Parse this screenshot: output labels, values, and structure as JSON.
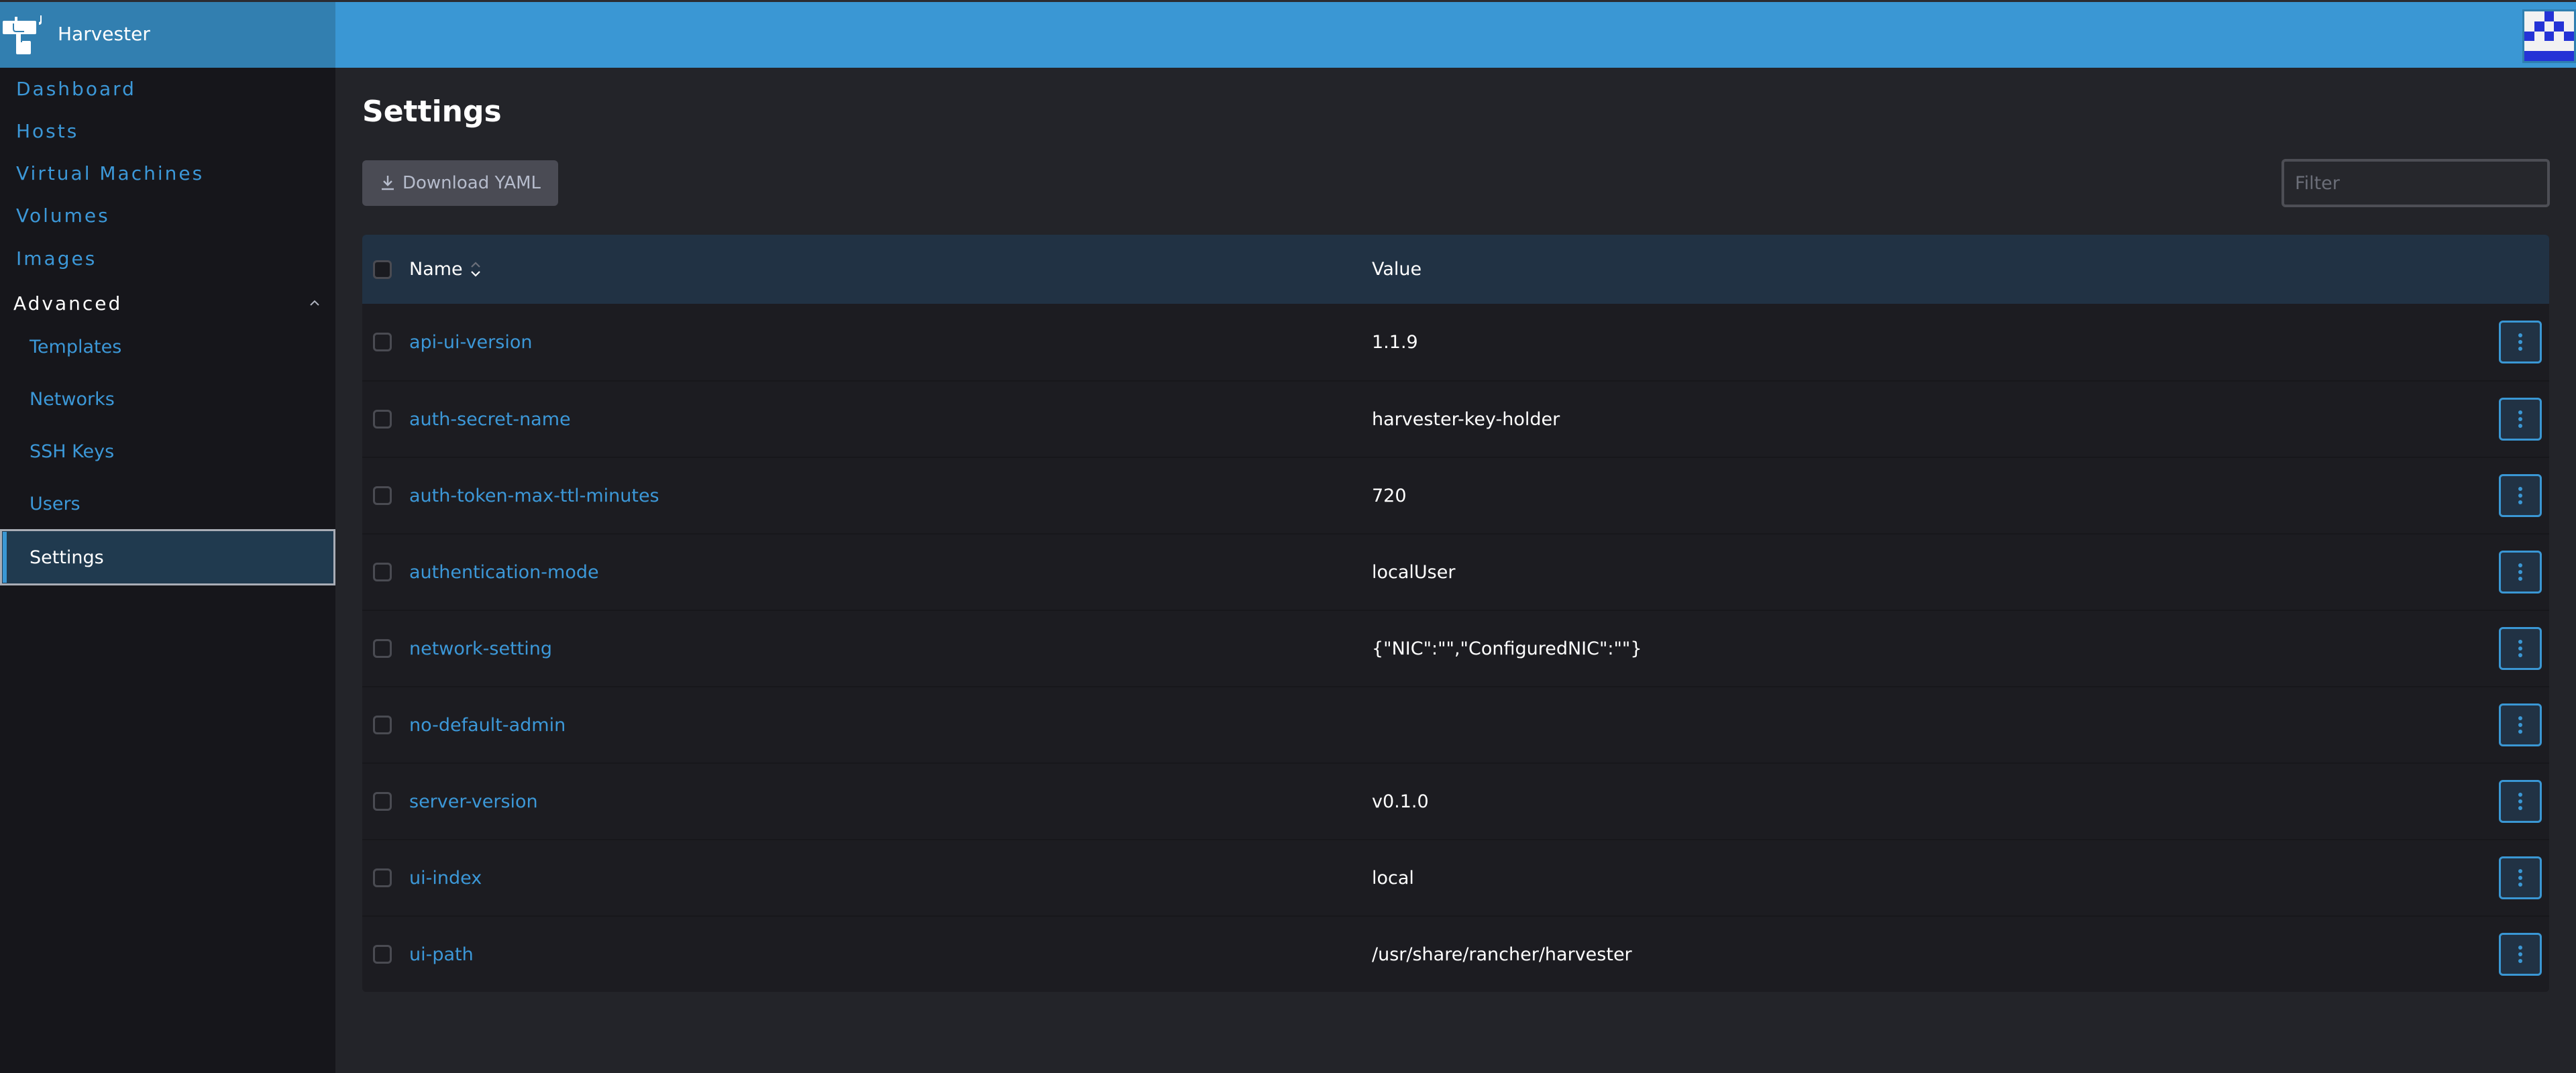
{
  "header": {
    "app_name": "Harvester",
    "logo_icon": "harvester-bull-logo",
    "avatar_icon": "identicon-avatar",
    "avatar_pattern": [
      [
        "w",
        "w",
        "b",
        "w",
        "w"
      ],
      [
        "w",
        "b",
        "w",
        "b",
        "w"
      ],
      [
        "b",
        "w",
        "b",
        "w",
        "b"
      ],
      [
        "w",
        "w",
        "w",
        "w",
        "w"
      ],
      [
        "b",
        "b",
        "b",
        "b",
        "b"
      ]
    ],
    "colors": {
      "header_bg": "#3a97d4",
      "brand_bg": "#327fb0",
      "avatar_fg": "#2433d6",
      "avatar_bg": "#f2f2f2"
    }
  },
  "sidebar": {
    "items": [
      {
        "label": "Dashboard"
      },
      {
        "label": "Hosts"
      },
      {
        "label": "Virtual Machines"
      },
      {
        "label": "Volumes"
      },
      {
        "label": "Images"
      }
    ],
    "group": {
      "label": "Advanced",
      "expanded": true,
      "chevron_icon": "chevron-up-icon",
      "items": [
        {
          "label": "Templates",
          "active": false
        },
        {
          "label": "Networks",
          "active": false
        },
        {
          "label": "SSH Keys",
          "active": false
        },
        {
          "label": "Users",
          "active": false
        },
        {
          "label": "Settings",
          "active": true
        }
      ]
    },
    "colors": {
      "link": "#3c98d8",
      "active_bg": "#203a4f",
      "active_indicator": "#3a97d4"
    }
  },
  "main": {
    "title": "Settings",
    "download_button": {
      "label": "Download YAML",
      "icon": "download-icon"
    },
    "filter": {
      "placeholder": "Filter",
      "value": ""
    },
    "table": {
      "columns": [
        {
          "label": "Name",
          "sortable": true,
          "sort_icon": "sort-icon"
        },
        {
          "label": "Value"
        }
      ],
      "rows": [
        {
          "name": "api-ui-version",
          "value": "1.1.9"
        },
        {
          "name": "auth-secret-name",
          "value": "harvester-key-holder"
        },
        {
          "name": "auth-token-max-ttl-minutes",
          "value": "720"
        },
        {
          "name": "authentication-mode",
          "value": "localUser"
        },
        {
          "name": "network-setting",
          "value": "{\"NIC\":\"\",\"ConfiguredNIC\":\"\"}"
        },
        {
          "name": "no-default-admin",
          "value": ""
        },
        {
          "name": "server-version",
          "value": "v0.1.0"
        },
        {
          "name": "ui-index",
          "value": "local"
        },
        {
          "name": "ui-path",
          "value": "/usr/share/rancher/harvester"
        }
      ],
      "row_action_icon": "more-vertical-icon"
    }
  }
}
